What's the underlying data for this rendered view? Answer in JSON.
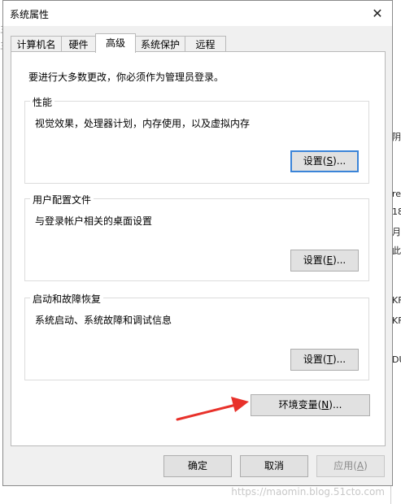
{
  "background": {
    "right_fragments": [
      "阴",
      "re",
      "18",
      "月",
      "此",
      "KF",
      "KF",
      "DU"
    ],
    "left_fragments": [
      "三",
      "三"
    ]
  },
  "dialog": {
    "title": "系统属性",
    "close_glyph": "✕",
    "tabs": [
      {
        "label": "计算机名",
        "active": false
      },
      {
        "label": "硬件",
        "active": false
      },
      {
        "label": "高级",
        "active": true
      },
      {
        "label": "系统保护",
        "active": false
      },
      {
        "label": "远程",
        "active": false
      }
    ],
    "admin_note": "要进行大多数更改，你必须作为管理员登录。",
    "performance": {
      "label": "性能",
      "description": "视觉效果，处理器计划，内存使用，以及虚拟内存",
      "button_prefix": "设置(",
      "button_key": "S",
      "button_suffix": ")..."
    },
    "user_profiles": {
      "label": "用户配置文件",
      "description": "与登录帐户相关的桌面设置",
      "button_prefix": "设置(",
      "button_key": "E",
      "button_suffix": ")..."
    },
    "startup_recovery": {
      "label": "启动和故障恢复",
      "description": "系统启动、系统故障和调试信息",
      "button_prefix": "设置(",
      "button_key": "T",
      "button_suffix": ")..."
    },
    "env_button": {
      "prefix": "环境变量(",
      "key": "N",
      "suffix": ")..."
    },
    "footer": {
      "ok": "确定",
      "cancel": "取消",
      "apply_prefix": "应用(",
      "apply_key": "A",
      "apply_suffix": ")"
    }
  },
  "annotation": {
    "arrow_color": "#e8312a"
  },
  "watermark": "https://maomin.blog.51cto.com"
}
